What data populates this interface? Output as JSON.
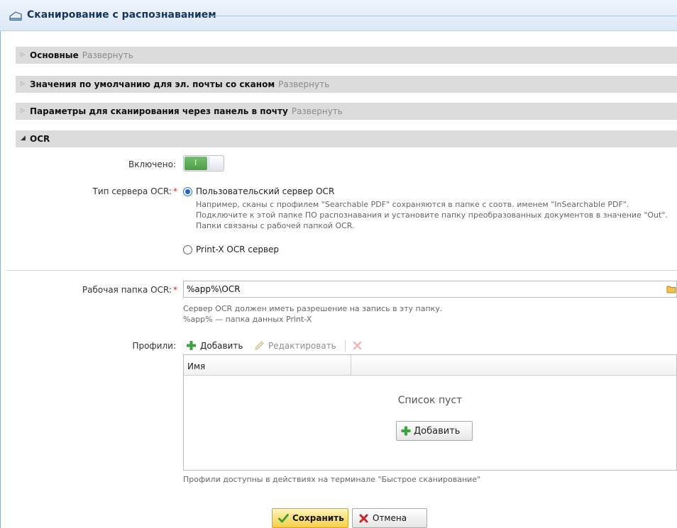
{
  "window": {
    "title": "Сканирование с распознаванием"
  },
  "sections": [
    {
      "title": "Основные",
      "expand": "Развернуть"
    },
    {
      "title": "Значения по умолчанию для эл. почты со сканом",
      "expand": "Развернуть"
    },
    {
      "title": "Параметры для сканирования через панель в почту",
      "expand": "Развернуть"
    },
    {
      "title": "OCR"
    }
  ],
  "ocr": {
    "enabled_label": "Включено:",
    "enabled_toggle_text": "I",
    "enabled": true,
    "server_type_label": "Тип сервера OCR:",
    "required_mark": "*",
    "server_options": [
      {
        "label": "Пользовательский сервер OCR",
        "selected": true
      },
      {
        "label": "Print-X OCR сервер",
        "selected": false
      }
    ],
    "custom_hint": [
      "Например, сканы с профилем \"Searchable PDF\" сохраняются в папке с соотв. именем \"InSearchable PDF\".",
      "Подключите к этой папке ПО распознавания и установите папку преобразованных документов в значение \"Out\".",
      "Папки связаны с рабочей папкой OCR."
    ],
    "work_folder_label": "Рабочая папка OCR:",
    "work_folder_value": "%app%\\OCR",
    "work_folder_hint": [
      "Сервер OCR должен иметь разрешение на запись в эту папку.",
      "%app% — папка данных Print-X"
    ],
    "profiles_label": "Профили:",
    "toolbar": {
      "add": "Добавить",
      "edit": "Редактировать"
    },
    "grid": {
      "columns": [
        "Имя"
      ],
      "empty_text": "Список пуст",
      "add_button": "Добавить"
    },
    "profiles_hint": "Профили доступны в действиях на терминале \"Быстрое сканирование\""
  },
  "footer": {
    "save": "Сохранить",
    "cancel": "Отмена"
  },
  "colors": {
    "accent_blue": "#1f63c9",
    "toggle_on": "#5aab53",
    "save_button": "#f5cf48",
    "section_bar": "#dcdcdc",
    "required": "#d21f1f"
  }
}
